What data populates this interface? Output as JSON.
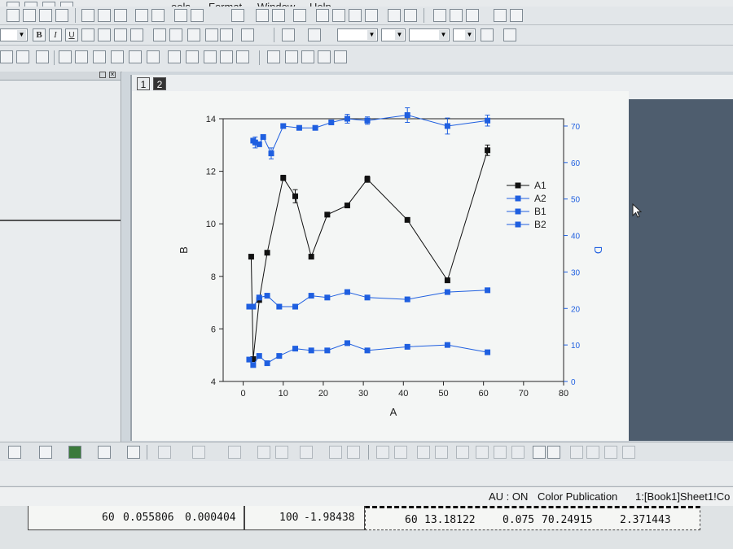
{
  "menu": {
    "items": [
      "ools",
      "Format",
      "Window",
      "Help"
    ]
  },
  "toolbar": {
    "bold_label": "B",
    "italic_label": "I",
    "underline_label": "U"
  },
  "graph_window": {
    "layer_tabs": [
      "1",
      "2"
    ]
  },
  "status": {
    "autoupdate": "AU : ON",
    "mode": "Color Publication",
    "active_sheet": "1:[Book1]Sheet1!Co"
  },
  "data_row": {
    "cells": [
      "60",
      "0.055806",
      "0.000404",
      "100",
      "-1.98438",
      "60",
      "13.18122",
      "0.075",
      "70.24915",
      "2.371443"
    ]
  },
  "chart_data": {
    "type": "line",
    "xlabel": "A",
    "ylabel": "B",
    "ylabel_right": "D",
    "xlim": [
      -5,
      80
    ],
    "ylim": [
      4,
      14
    ],
    "ylim_right": [
      0,
      72
    ],
    "xticks": [
      "0",
      "10",
      "20",
      "30",
      "40",
      "50",
      "60",
      "70",
      "80"
    ],
    "yticks": [
      "4",
      "6",
      "8",
      "10",
      "12",
      "14"
    ],
    "yticks_right": [
      "0",
      "10",
      "20",
      "30",
      "40",
      "50",
      "60",
      "70"
    ],
    "legend_position": "top-right",
    "series": [
      {
        "name": "A1",
        "axis": "left",
        "color": "#111111",
        "marker": "square",
        "x": [
          2,
          2.5,
          4,
          6,
          10,
          13,
          17,
          21,
          26,
          31,
          41,
          51,
          61
        ],
        "y": [
          8.75,
          4.85,
          7.1,
          8.9,
          11.75,
          11.05,
          8.75,
          10.35,
          10.7,
          11.7,
          10.15,
          7.85,
          12.8
        ],
        "err": [
          0,
          0,
          0,
          0,
          0.1,
          0.25,
          0,
          0,
          0,
          0.12,
          0,
          0,
          0.2
        ]
      },
      {
        "name": "A2",
        "axis": "right",
        "color": "#1f5fe0",
        "marker": "square",
        "x": [
          1.5,
          2.5,
          4,
          6,
          9,
          13,
          17,
          21,
          26,
          31,
          41,
          51,
          61
        ],
        "y": [
          6,
          4.5,
          7,
          5,
          7,
          9,
          8.5,
          8.5,
          10.5,
          8.5,
          9.5,
          10,
          8
        ]
      },
      {
        "name": "B1",
        "axis": "right",
        "color": "#1f5fe0",
        "marker": "square",
        "x": [
          1.5,
          2.5,
          4,
          6,
          9,
          13,
          17,
          21,
          26,
          31,
          41,
          51,
          61
        ],
        "y": [
          20.5,
          20.5,
          23,
          23.5,
          20.5,
          20.5,
          23.5,
          23,
          24.5,
          23,
          22.5,
          24.5,
          25
        ]
      },
      {
        "name": "B2",
        "axis": "right",
        "color": "#1f5fe0",
        "marker": "square",
        "x": [
          2.5,
          3,
          4,
          5,
          7,
          10,
          14,
          18,
          22,
          26,
          31,
          41,
          51,
          61
        ],
        "y": [
          66,
          65.5,
          65,
          67,
          62.5,
          70,
          69.5,
          69.5,
          71,
          72,
          71.5,
          73,
          70,
          71.5
        ],
        "err": [
          0,
          1.5,
          0,
          0,
          1.5,
          0,
          0,
          0,
          0,
          1.2,
          1,
          2,
          2.2,
          1.5
        ]
      }
    ]
  }
}
